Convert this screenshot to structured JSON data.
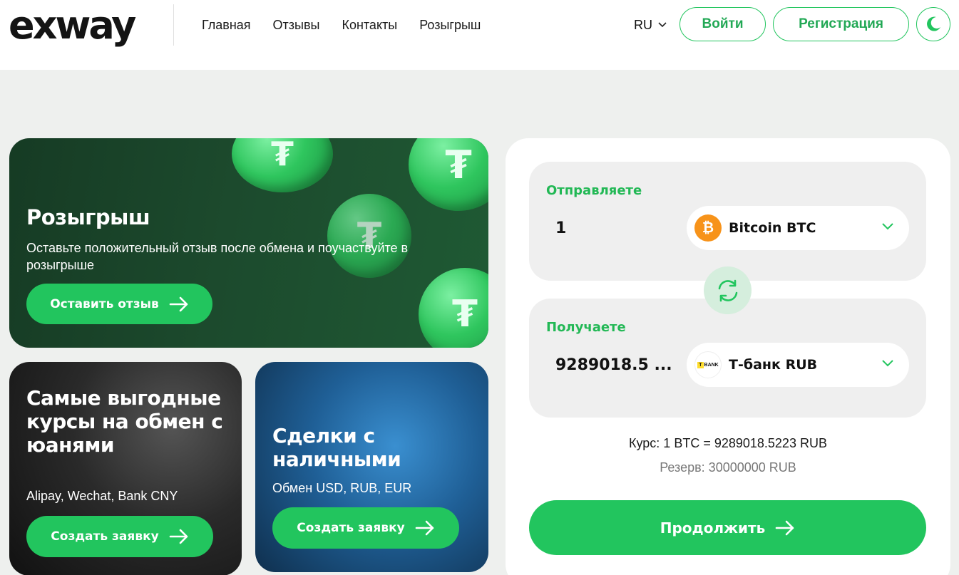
{
  "header": {
    "logo": "exway",
    "nav": [
      "Главная",
      "Отзывы",
      "Контакты",
      "Розыгрыш"
    ],
    "language": "RU",
    "login_label": "Войти",
    "register_label": "Регистрация",
    "theme_icon": "moon-icon"
  },
  "cards": {
    "raffle": {
      "title": "Розыгрыш",
      "text": "Оставьте положительный отзыв после обмена и поучаствуйте в розыгрыше",
      "button": "Оставить отзыв"
    },
    "yuan": {
      "title": "Самые выгодные курсы на обмен с юанями",
      "text": "Alipay, Wechat, Bank CNY",
      "button": "Создать заявку"
    },
    "cash": {
      "title": "Сделки с наличными",
      "text": "Обмен USD, RUB, EUR",
      "button": "Создать заявку"
    }
  },
  "exchange": {
    "send_label": "Отправляете",
    "send_amount": "1",
    "send_currency": "Bitcoin BTC",
    "send_icon": "bitcoin-icon",
    "receive_label": "Получаете",
    "receive_amount": "9289018.5 ...",
    "receive_currency": "Т-банк RUB",
    "receive_icon": "tbank-icon",
    "rate": "Курс: 1 BTC = 9289018.5223 RUB",
    "reserve": "Резерв: 30000000 RUB",
    "continue_label": "Продолжить"
  },
  "colors": {
    "accent": "#22c55e",
    "accent_text": "#22a855",
    "page_bg": "#eef0ee"
  }
}
